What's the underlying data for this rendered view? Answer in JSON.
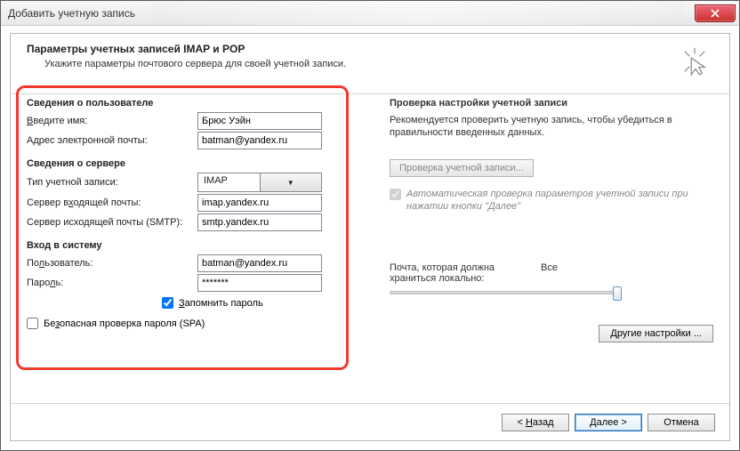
{
  "window": {
    "title": "Добавить учетную запись"
  },
  "header": {
    "title": "Параметры учетных записей IMAP и POP",
    "subtitle": "Укажите параметры почтового сервера для своей учетной записи."
  },
  "user_info": {
    "section": "Сведения о пользователе",
    "name_label": "Введите имя:",
    "name_value": "Брюс Уэйн",
    "email_label": "Адрес электронной почты:",
    "email_value": "batman@yandex.ru"
  },
  "server_info": {
    "section": "Сведения о сервере",
    "acct_type_label": "Тип учетной записи:",
    "acct_type_value": "IMAP",
    "incoming_label": "Сервер входящей почты:",
    "incoming_value": "imap.yandex.ru",
    "outgoing_label": "Сервер исходящей почты (SMTP):",
    "outgoing_value": "smtp.yandex.ru"
  },
  "login_info": {
    "section": "Вход в систему",
    "user_label": "Пользователь:",
    "user_value": "batman@yandex.ru",
    "pass_label": "Пароль:",
    "pass_value": "*******",
    "remember_label": "Запомнить пароль",
    "spa_label": "Безопасная проверка пароля (SPA)"
  },
  "test": {
    "title": "Проверка настройки учетной записи",
    "desc": "Рекомендуется проверить учетную запись, чтобы убедиться в правильности введенных данных.",
    "button": "Проверка учетной записи...",
    "auto_label": "Автоматическая проверка параметров учетной записи при нажатии кнопки \"Далее\""
  },
  "storage": {
    "label": "Почта, которая должна храниться локально:",
    "value": "Все"
  },
  "other_settings": "Другие настройки ...",
  "footer": {
    "back": "< Назад",
    "next": "Далее >",
    "cancel": "Отмена"
  }
}
